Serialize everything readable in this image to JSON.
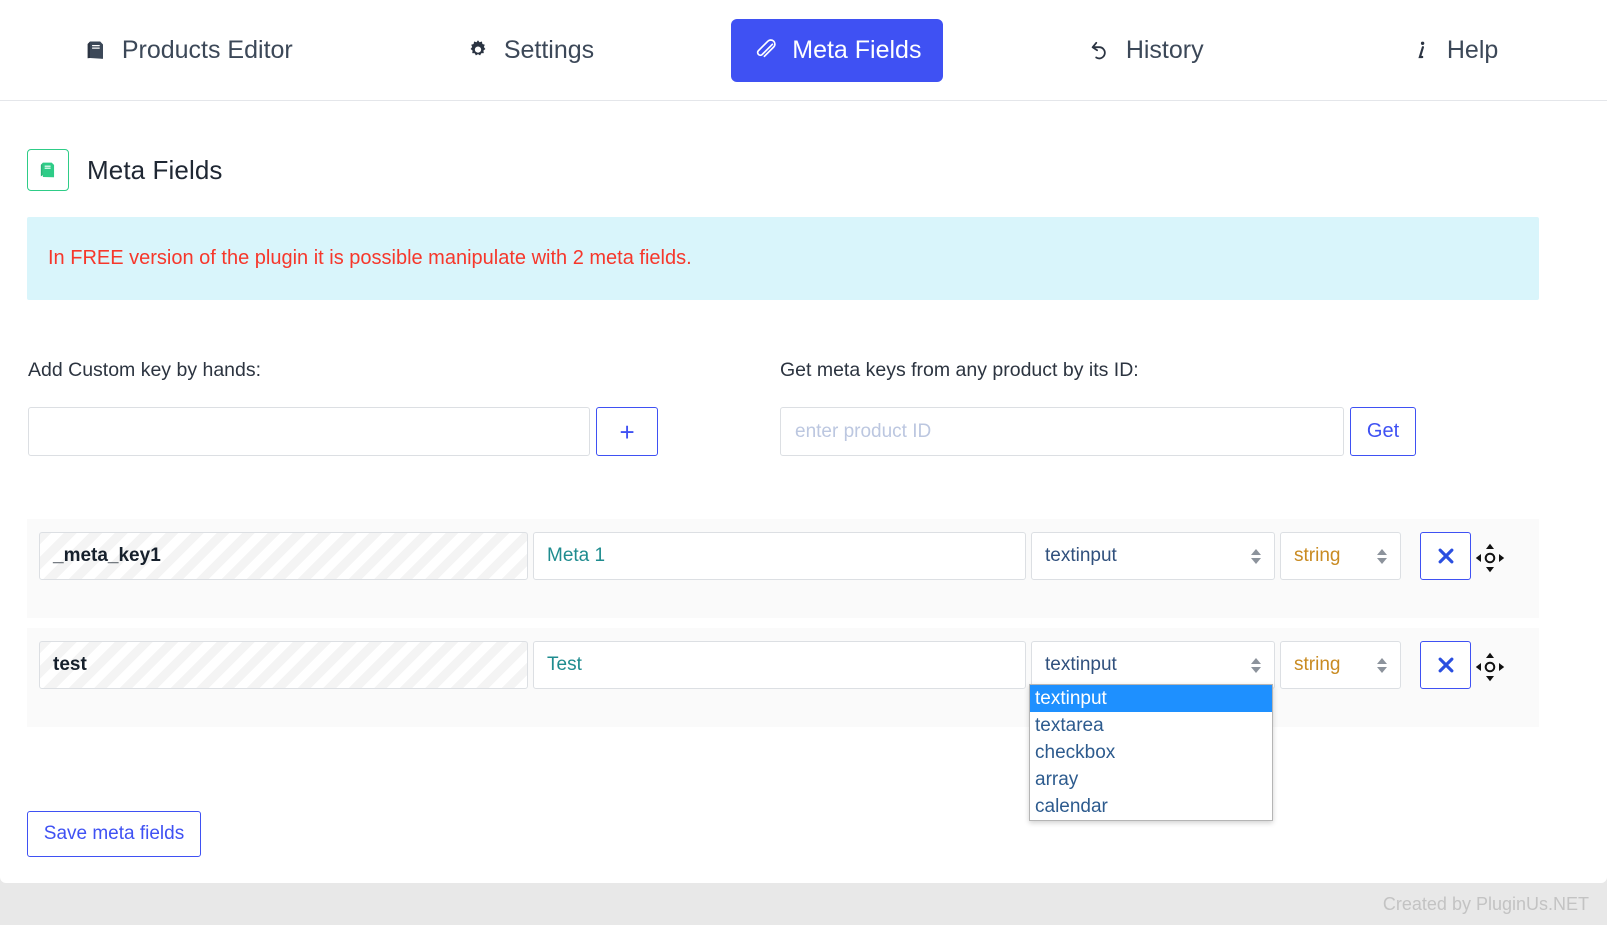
{
  "tabs": [
    {
      "label": "Products Editor",
      "icon": "book-icon",
      "active": false
    },
    {
      "label": "Settings",
      "icon": "gear-icon",
      "active": false
    },
    {
      "label": "Meta Fields",
      "icon": "paperclip-icon",
      "active": true
    },
    {
      "label": "History",
      "icon": "undo-icon",
      "active": false
    },
    {
      "label": "Help",
      "icon": "info-icon",
      "active": false
    }
  ],
  "section": {
    "title": "Meta Fields",
    "icon": "book-icon"
  },
  "notice": {
    "text": "In FREE version of the plugin it is possible manipulate with 2 meta fields."
  },
  "add_custom": {
    "label": "Add Custom key by hands:",
    "input_value": "",
    "input_placeholder": "",
    "button_label": "+"
  },
  "get_meta": {
    "label": "Get meta keys from any product by its ID:",
    "input_value": "",
    "input_placeholder": "enter product ID",
    "button_label": "Get"
  },
  "meta_rows": [
    {
      "key": "_meta_key1",
      "label": "Meta 1",
      "field_type": "textinput",
      "value_type": "string",
      "delete_label": "✖",
      "handle": "move-icon"
    },
    {
      "key": "test",
      "label": "Test",
      "field_type": "textinput",
      "value_type": "string",
      "delete_label": "✖",
      "handle": "move-icon"
    }
  ],
  "dropdown": {
    "open": true,
    "selected": "textinput",
    "options": [
      "textinput",
      "textarea",
      "checkbox",
      "array",
      "calendar"
    ]
  },
  "save": {
    "label": "Save meta fields"
  },
  "footer": {
    "text": "Created by PluginUs.NET"
  },
  "colors": {
    "accent_blue": "#3f51f3",
    "highlight_blue": "#1e90ff",
    "notice_bg": "#d9f5fb",
    "notice_text": "#f6372b",
    "green": "#2ecc87",
    "teal": "#1f8c8f",
    "amber": "#c98b22"
  }
}
